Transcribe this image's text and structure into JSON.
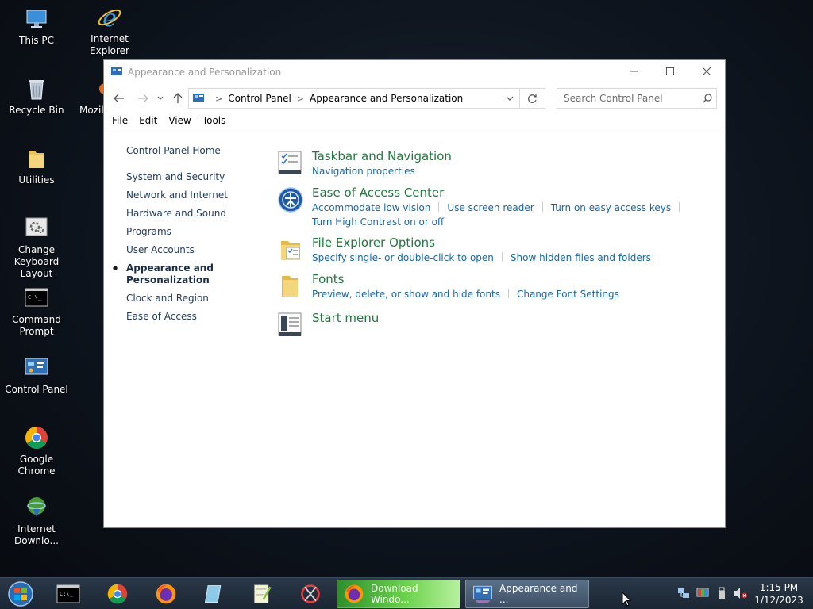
{
  "desktop": {
    "icons": [
      {
        "label": "This PC"
      },
      {
        "label": "Internet Explorer"
      },
      {
        "label": "Recycle Bin"
      },
      {
        "label": "Mozil"
      },
      {
        "label": "Utilities"
      },
      {
        "label": "Change Keyboard Layout"
      },
      {
        "label": "Command Prompt"
      },
      {
        "label": "Control Panel"
      },
      {
        "label": "Google Chrome"
      },
      {
        "label": "Internet Downlo..."
      }
    ]
  },
  "window": {
    "title": "Appearance and Personalization",
    "breadcrumb": [
      "Control Panel",
      "Appearance and Personalization"
    ],
    "search_placeholder": "Search Control Panel",
    "menu": [
      "File",
      "Edit",
      "View",
      "Tools"
    ],
    "sidebar": {
      "home": "Control Panel Home",
      "items": [
        "System and Security",
        "Network and Internet",
        "Hardware and Sound",
        "Programs",
        "User Accounts",
        "Appearance and Personalization",
        "Clock and Region",
        "Ease of Access"
      ]
    },
    "categories": [
      {
        "title": "Taskbar and Navigation",
        "links": [
          "Navigation properties"
        ]
      },
      {
        "title": "Ease of Access Center",
        "links": [
          "Accommodate low vision",
          "Use screen reader",
          "Turn on easy access keys",
          "Turn High Contrast on or off"
        ]
      },
      {
        "title": "File Explorer Options",
        "links": [
          "Specify single- or double-click to open",
          "Show hidden files and folders"
        ]
      },
      {
        "title": "Fonts",
        "links": [
          "Preview, delete, or show and hide fonts",
          "Change Font Settings"
        ]
      },
      {
        "title": "Start menu",
        "links": []
      }
    ]
  },
  "taskbar": {
    "tasks": [
      "Download Windo...",
      "Appearance and ..."
    ],
    "clock": {
      "time": "1:15 PM",
      "date": "1/12/2023"
    }
  },
  "colors": {
    "category_title": "#1e7a3c",
    "link": "#1467b0",
    "sidebar_link": "#1f3a5f"
  }
}
